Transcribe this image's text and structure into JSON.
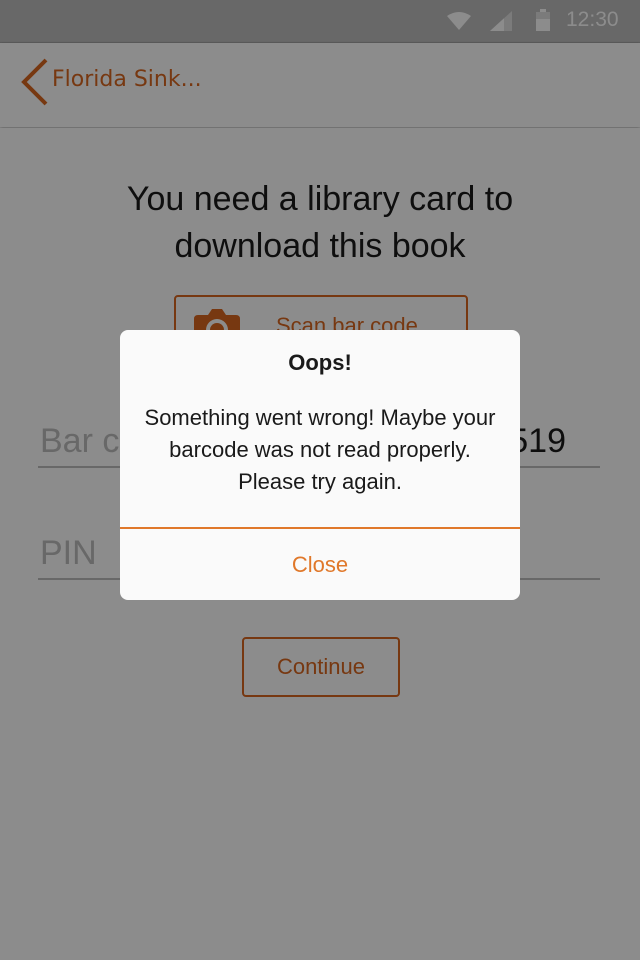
{
  "status_bar": {
    "time": "12:30",
    "icons": [
      "wifi-icon",
      "signal-icon",
      "battery-icon"
    ]
  },
  "app_bar": {
    "back_icon": "chevron-left-icon",
    "title": "Florida Sink..."
  },
  "main": {
    "headline": "You need a library card to download this book",
    "scan_button": {
      "label": "Scan bar code",
      "icon": "camera-icon"
    },
    "barcode_field": {
      "placeholder": "Bar c",
      "value": "519"
    },
    "pin_field": {
      "placeholder": "PIN",
      "value": ""
    },
    "continue_button": {
      "label": "Continue"
    }
  },
  "dialog": {
    "title": "Oops!",
    "message": "Something went wrong! Maybe your barcode was not read properly. Please try again.",
    "close_label": "Close"
  },
  "colors": {
    "accent": "#d9661f",
    "dialog_accent": "#e0782a",
    "scrim": "rgba(0,0,0,0.45)"
  }
}
